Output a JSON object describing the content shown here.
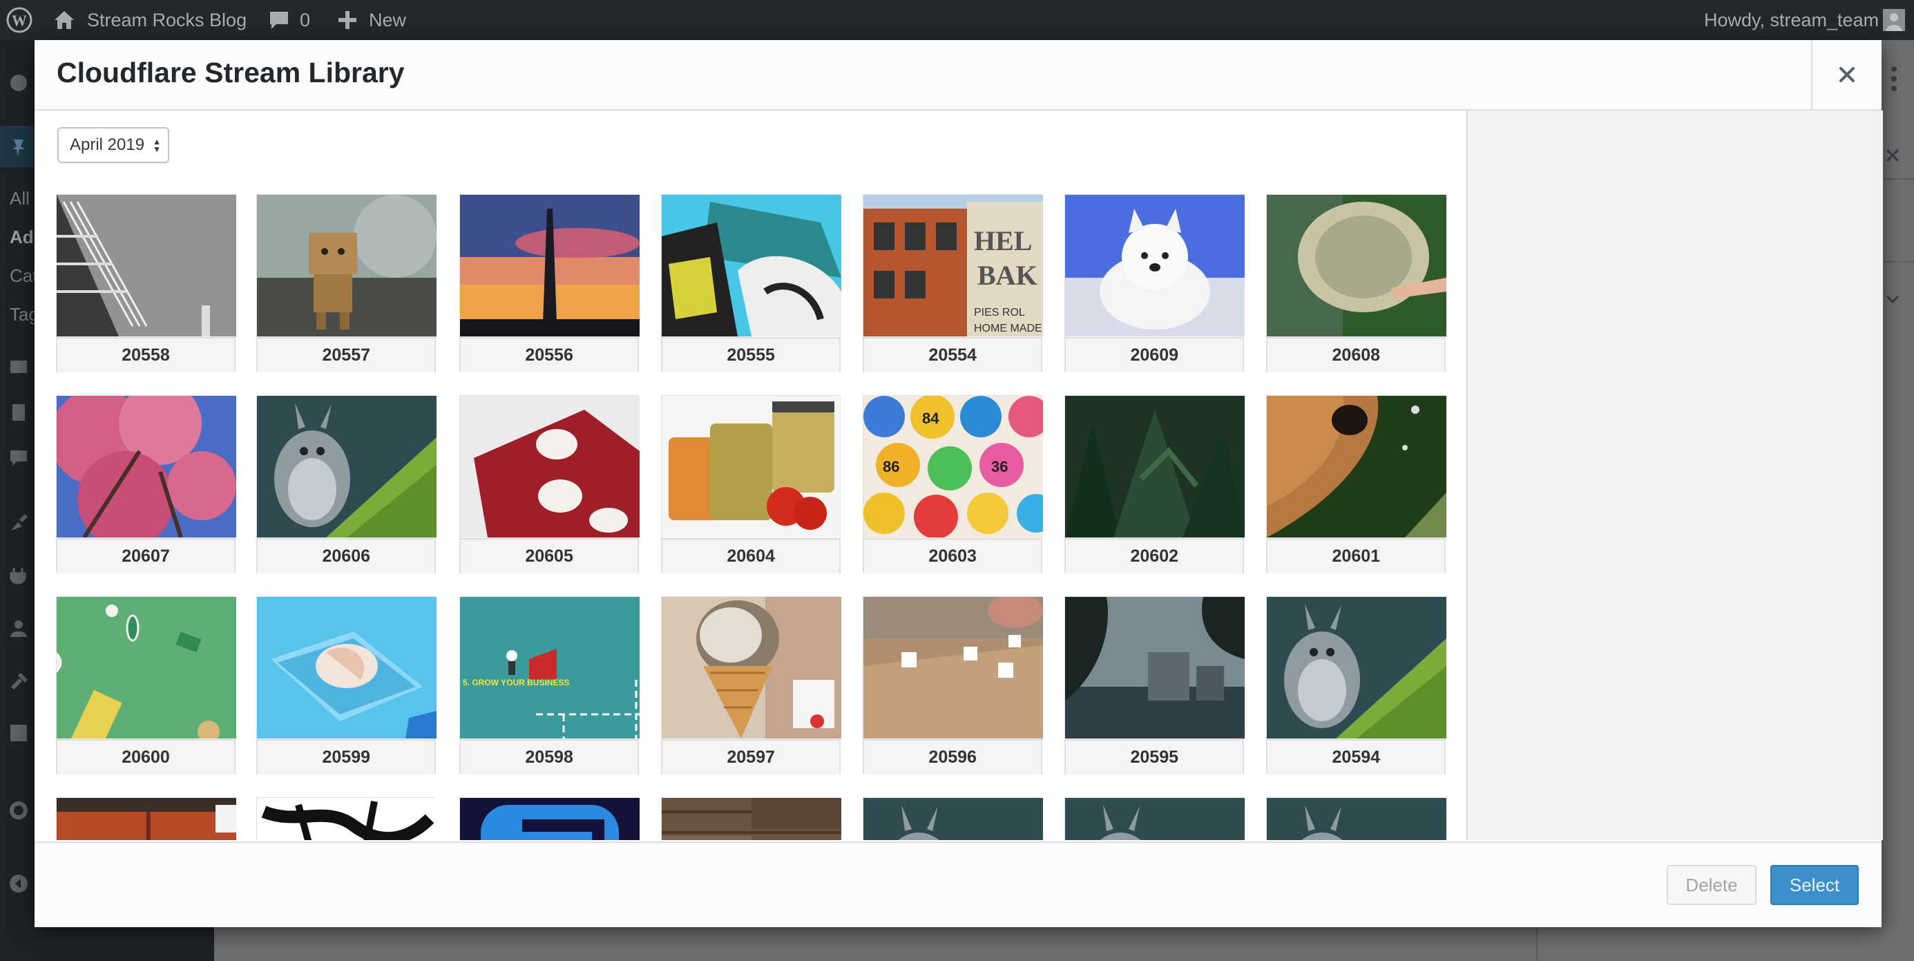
{
  "admin_bar": {
    "site_name": "Stream Rocks Blog",
    "comments_count": "0",
    "new_label": "New",
    "greeting": "Howdy, stream_team"
  },
  "wp_sidebar": {
    "items": [
      "All",
      "Add",
      "Cat",
      "Tag"
    ]
  },
  "modal": {
    "title": "Cloudflare Stream Library",
    "close_icon": "close-icon",
    "date_filter": {
      "selected": "April 2019"
    },
    "videos": [
      {
        "id": "20558",
        "thumb": "stairs"
      },
      {
        "id": "20557",
        "thumb": "cardboard-robot"
      },
      {
        "id": "20556",
        "thumb": "monument-sunset"
      },
      {
        "id": "20555",
        "thumb": "cartoon-badger"
      },
      {
        "id": "20554",
        "thumb": "bakery-building"
      },
      {
        "id": "20609",
        "thumb": "white-puppy"
      },
      {
        "id": "20608",
        "thumb": "fuzzy-plant"
      },
      {
        "id": "20607",
        "thumb": "cherry-blossom"
      },
      {
        "id": "20606",
        "thumb": "big-buck-bunny"
      },
      {
        "id": "20605",
        "thumb": "red-dice"
      },
      {
        "id": "20604",
        "thumb": "pickle-jars"
      },
      {
        "id": "20603",
        "thumb": "lottery-balls"
      },
      {
        "id": "20602",
        "thumb": "pine-trees"
      },
      {
        "id": "20601",
        "thumb": "dog-nose"
      },
      {
        "id": "20600",
        "thumb": "green-desk"
      },
      {
        "id": "20599",
        "thumb": "seashell"
      },
      {
        "id": "20598",
        "thumb": "grow-business"
      },
      {
        "id": "20597",
        "thumb": "ice-cream"
      },
      {
        "id": "20596",
        "thumb": "dice-table"
      },
      {
        "id": "20595",
        "thumb": "foggy-city"
      },
      {
        "id": "20594",
        "thumb": "big-buck-bunny"
      },
      {
        "id": "",
        "thumb": "train"
      },
      {
        "id": "",
        "thumb": "brush-strokes"
      },
      {
        "id": "",
        "thumb": "blue-shape"
      },
      {
        "id": "",
        "thumb": "wood-texture"
      },
      {
        "id": "",
        "thumb": "big-buck-bunny"
      },
      {
        "id": "",
        "thumb": "big-buck-bunny"
      },
      {
        "id": "",
        "thumb": "big-buck-bunny"
      }
    ],
    "grow_business_text": "5. GROW YOUR BUSINESS",
    "footer": {
      "delete_label": "Delete",
      "select_label": "Select"
    }
  },
  "colors": {
    "admin_bar": "#23282d",
    "primary_button": "#3d8fca"
  }
}
